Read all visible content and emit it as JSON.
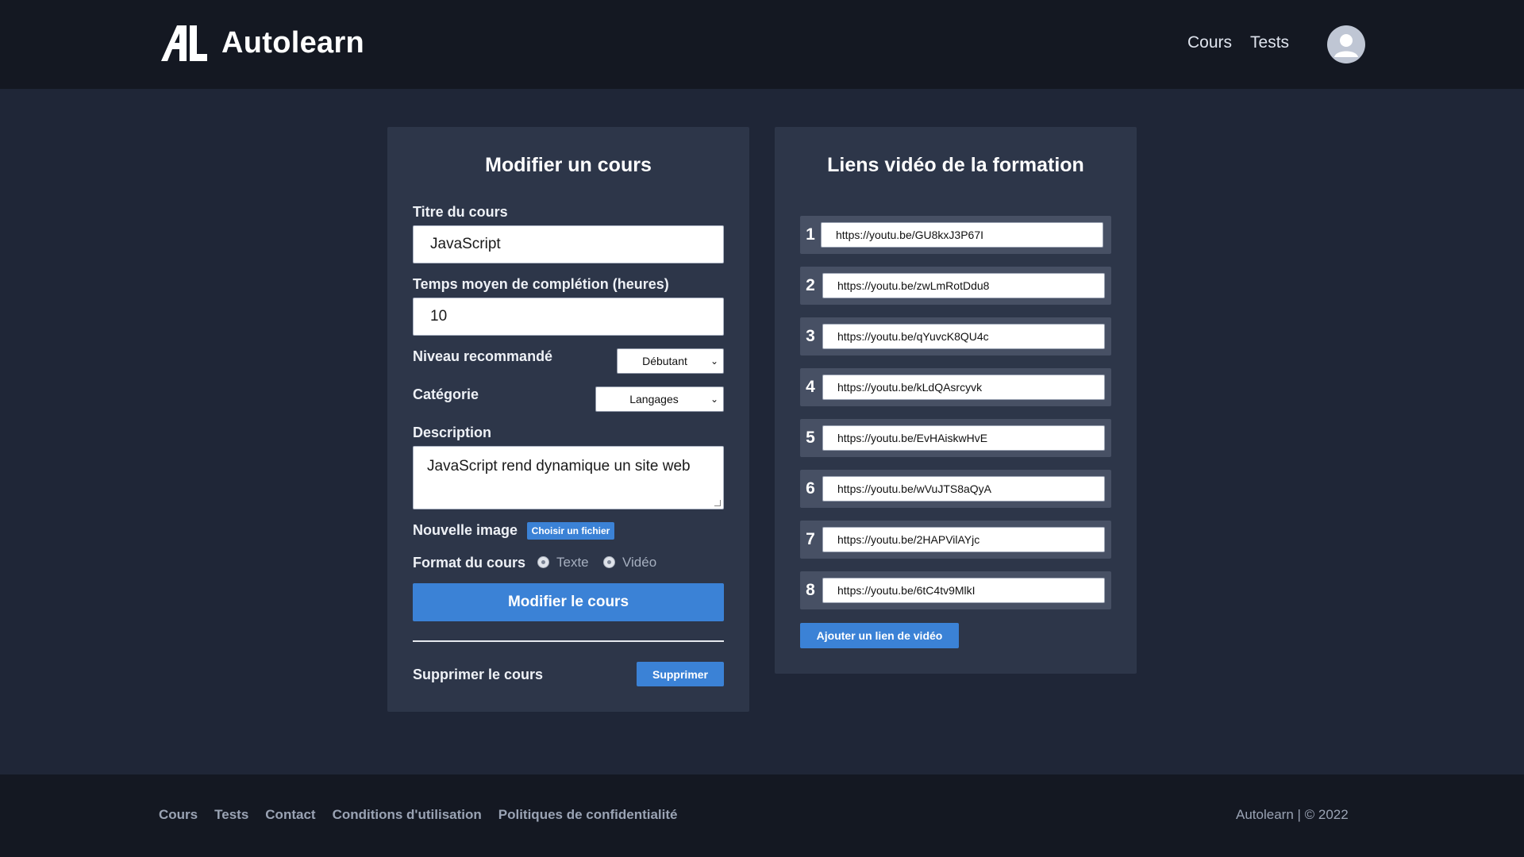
{
  "app": {
    "name": "Autolearn",
    "logo_mark": "AL"
  },
  "header": {
    "nav": [
      {
        "label": "Cours"
      },
      {
        "label": "Tests"
      }
    ],
    "avatar_icon": "user-avatar-icon"
  },
  "edit_form": {
    "title": "Modifier un cours",
    "course_title_label": "Titre du cours",
    "course_title_value": "JavaScript",
    "completion_label": "Temps moyen de complétion (heures)",
    "completion_value": "10",
    "level_label": "Niveau recommandé",
    "level_value": "Débutant",
    "category_label": "Catégorie",
    "category_value": "Langages",
    "description_label": "Description",
    "description_value": "JavaScript rend dynamique un site web",
    "image_label": "Nouvelle image",
    "file_button": "Choisir un fichier",
    "format_label": "Format du cours",
    "format_options": [
      {
        "label": "Texte"
      },
      {
        "label": "Vidéo"
      }
    ],
    "submit_button": "Modifier le cours",
    "delete_label": "Supprimer le cours",
    "delete_button": "Supprimer"
  },
  "video_links": {
    "title": "Liens vidéo de la formation",
    "links": [
      {
        "num": "1",
        "url": "https://youtu.be/GU8kxJ3P67I"
      },
      {
        "num": "2",
        "url": "https://youtu.be/zwLmRotDdu8"
      },
      {
        "num": "3",
        "url": "https://youtu.be/qYuvcK8QU4c"
      },
      {
        "num": "4",
        "url": "https://youtu.be/kLdQAsrcyvk"
      },
      {
        "num": "5",
        "url": "https://youtu.be/EvHAiskwHvE"
      },
      {
        "num": "6",
        "url": "https://youtu.be/wVuJTS8aQyA"
      },
      {
        "num": "7",
        "url": "https://youtu.be/2HAPVilAYjc"
      },
      {
        "num": "8",
        "url": "https://youtu.be/6tC4tv9MlkI"
      }
    ],
    "add_button": "Ajouter un lien de vidéo"
  },
  "footer": {
    "links": [
      {
        "label": "Cours"
      },
      {
        "label": "Tests"
      },
      {
        "label": "Contact"
      },
      {
        "label": "Conditions d'utilisation"
      },
      {
        "label": "Politiques de confidentialité"
      }
    ],
    "copyright": "Autolearn | © 2022"
  },
  "colors": {
    "background": "#1f2637",
    "header": "#141822",
    "card": "#2d3649",
    "accent": "#3b82d6"
  }
}
